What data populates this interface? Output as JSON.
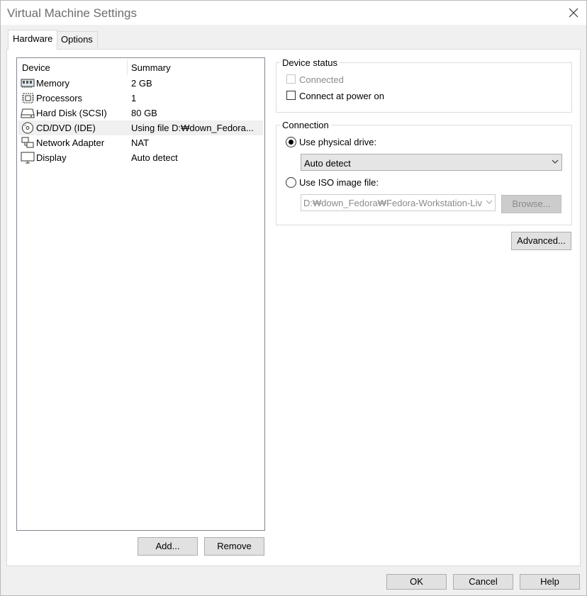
{
  "window": {
    "title": "Virtual Machine Settings"
  },
  "tabs": [
    {
      "label": "Hardware"
    },
    {
      "label": "Options"
    }
  ],
  "device_list": {
    "headers": {
      "device": "Device",
      "summary": "Summary"
    },
    "rows": [
      {
        "device": "Memory",
        "summary": "2 GB",
        "icon": "memory-icon"
      },
      {
        "device": "Processors",
        "summary": "1",
        "icon": "processor-icon"
      },
      {
        "device": "Hard Disk (SCSI)",
        "summary": "80 GB",
        "icon": "hard-disk-icon"
      },
      {
        "device": "CD/DVD (IDE)",
        "summary": "Using file D:₩down_Fedora...",
        "icon": "cd-dvd-icon",
        "selected": true
      },
      {
        "device": "Network Adapter",
        "summary": "NAT",
        "icon": "network-adapter-icon"
      },
      {
        "device": "Display",
        "summary": "Auto detect",
        "icon": "display-icon"
      }
    ]
  },
  "list_buttons": {
    "add": "Add...",
    "remove": "Remove"
  },
  "device_status": {
    "title": "Device status",
    "connected": {
      "label": "Connected",
      "checked": false,
      "enabled": false
    },
    "connect_at_power_on": {
      "label": "Connect at power on",
      "checked": false,
      "enabled": true
    }
  },
  "connection": {
    "title": "Connection",
    "use_physical_drive": {
      "label": "Use physical drive:",
      "selected": true
    },
    "physical_drive_value": "Auto detect",
    "use_iso": {
      "label": "Use ISO image file:",
      "selected": false
    },
    "iso_path": "D:₩down_Fedora₩Fedora-Workstation-Liv",
    "browse_label": "Browse..."
  },
  "advanced_label": "Advanced...",
  "dialog_buttons": {
    "ok": "OK",
    "cancel": "Cancel",
    "help": "Help"
  }
}
